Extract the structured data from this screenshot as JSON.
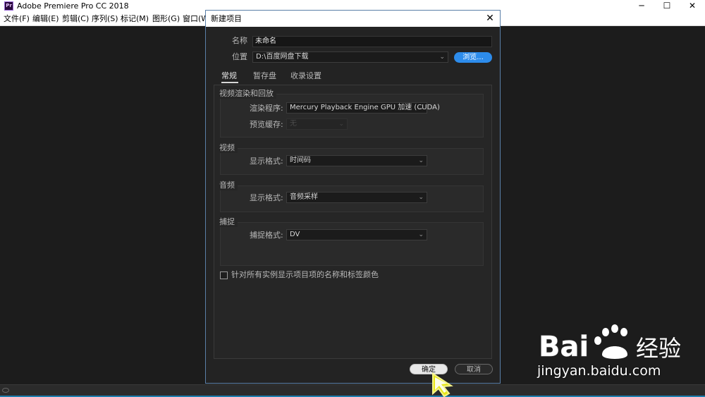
{
  "app": {
    "title": "Adobe Premiere Pro CC 2018",
    "logo_text": "Pr",
    "window_controls": [
      "─",
      "☐",
      "✕"
    ]
  },
  "menu": {
    "items": [
      "文件(F)",
      "编辑(E)",
      "剪辑(C)",
      "序列(S)",
      "标记(M)",
      "图形(G)",
      "窗口(W"
    ]
  },
  "dialog": {
    "title": "新建项目",
    "close_glyph": "✕",
    "name_label": "名称",
    "name_value": "未命名",
    "location_label": "位置",
    "location_value": "D:\\百度网盘下载",
    "browse_label": "浏览...",
    "tabs": [
      "常规",
      "暂存盘",
      "收录设置"
    ],
    "groups": {
      "video_render": {
        "title": "视频渲染和回放",
        "renderer_label": "渲染程序:",
        "renderer_value": "Mercury Playback Engine GPU 加速 (CUDA)",
        "preview_cache_label": "预览缓存:",
        "preview_cache_value": "无"
      },
      "video": {
        "title": "视频",
        "display_format_label": "显示格式:",
        "display_format_value": "时间码"
      },
      "audio": {
        "title": "音频",
        "display_format_label": "显示格式:",
        "display_format_value": "音频采样"
      },
      "capture": {
        "title": "捕捉",
        "capture_format_label": "捕捉格式:",
        "capture_format_value": "DV"
      }
    },
    "checkbox_label": "针对所有实例显示项目项的名称和标签颜色",
    "checkbox_checked": false,
    "ok_label": "确定",
    "cancel_label": "取消"
  },
  "watermark": {
    "text": "jingyan.baidu.com"
  },
  "colors": {
    "accent": "#2d8ceb",
    "cursor": "#e8e61a"
  }
}
